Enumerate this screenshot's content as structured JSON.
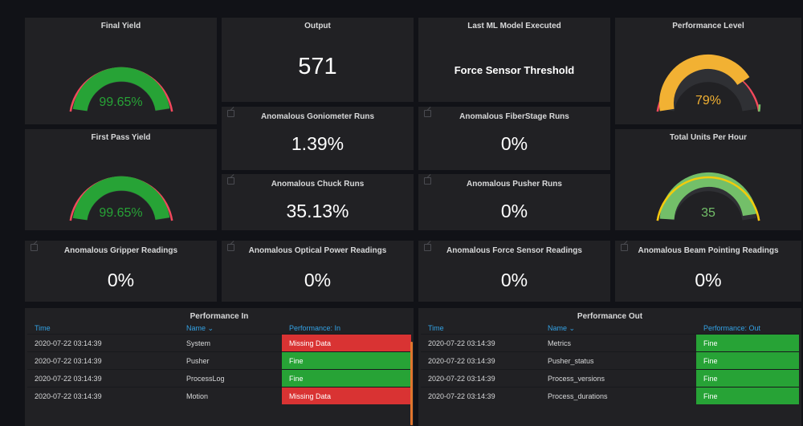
{
  "colors": {
    "green": "#27a336",
    "red": "#d93333",
    "orange": "#f2b133",
    "light_green": "#73bf69",
    "blue_header": "#33a2e5"
  },
  "final_yield": {
    "title": "Final Yield",
    "value": "99.65%",
    "fraction": 0.9965
  },
  "output": {
    "title": "Output",
    "value": "571"
  },
  "last_ml": {
    "title": "Last ML Model Executed",
    "value": "Force Sensor Threshold"
  },
  "performance_level": {
    "title": "Performance Level",
    "value": "79%",
    "fraction": 0.79
  },
  "first_pass_yield": {
    "title": "First Pass Yield",
    "value": "99.65%",
    "fraction": 0.9965
  },
  "goniometer": {
    "title": "Anomalous Goniometer Runs",
    "value": "1.39%"
  },
  "fiberstage": {
    "title": "Anomalous FiberStage Runs",
    "value": "0%"
  },
  "units_per_hour": {
    "title": "Total Units Per Hour",
    "value": "35",
    "fraction": 0.97
  },
  "chuck": {
    "title": "Anomalous Chuck Runs",
    "value": "35.13%"
  },
  "pusher": {
    "title": "Anomalous Pusher Runs",
    "value": "0%"
  },
  "gripper": {
    "title": "Anomalous Gripper Readings",
    "value": "0%"
  },
  "optical": {
    "title": "Anomalous Optical Power Readings",
    "value": "0%"
  },
  "force": {
    "title": "Anomalous Force Sensor Readings",
    "value": "0%"
  },
  "beam": {
    "title": "Anomalous Beam Pointing Readings",
    "value": "0%"
  },
  "perf_in": {
    "title": "Performance In",
    "headers": [
      "Time",
      "Name ⌄",
      "Performance: In"
    ],
    "rows": [
      {
        "time": "2020-07-22 03:14:39",
        "name": "System",
        "status": "Missing Data",
        "state": "bad"
      },
      {
        "time": "2020-07-22 03:14:39",
        "name": "Pusher",
        "status": "Fine",
        "state": "ok"
      },
      {
        "time": "2020-07-22 03:14:39",
        "name": "ProcessLog",
        "status": "Fine",
        "state": "ok"
      },
      {
        "time": "2020-07-22 03:14:39",
        "name": "Motion",
        "status": "Missing Data",
        "state": "bad"
      }
    ]
  },
  "perf_out": {
    "title": "Performance Out",
    "headers": [
      "Time",
      "Name ⌄",
      "Performance: Out"
    ],
    "rows": [
      {
        "time": "2020-07-22 03:14:39",
        "name": "Metrics",
        "status": "Fine",
        "state": "ok"
      },
      {
        "time": "2020-07-22 03:14:39",
        "name": "Pusher_status",
        "status": "Fine",
        "state": "ok"
      },
      {
        "time": "2020-07-22 03:14:39",
        "name": "Process_versions",
        "status": "Fine",
        "state": "ok"
      },
      {
        "time": "2020-07-22 03:14:39",
        "name": "Process_durations",
        "status": "Fine",
        "state": "ok"
      }
    ]
  }
}
